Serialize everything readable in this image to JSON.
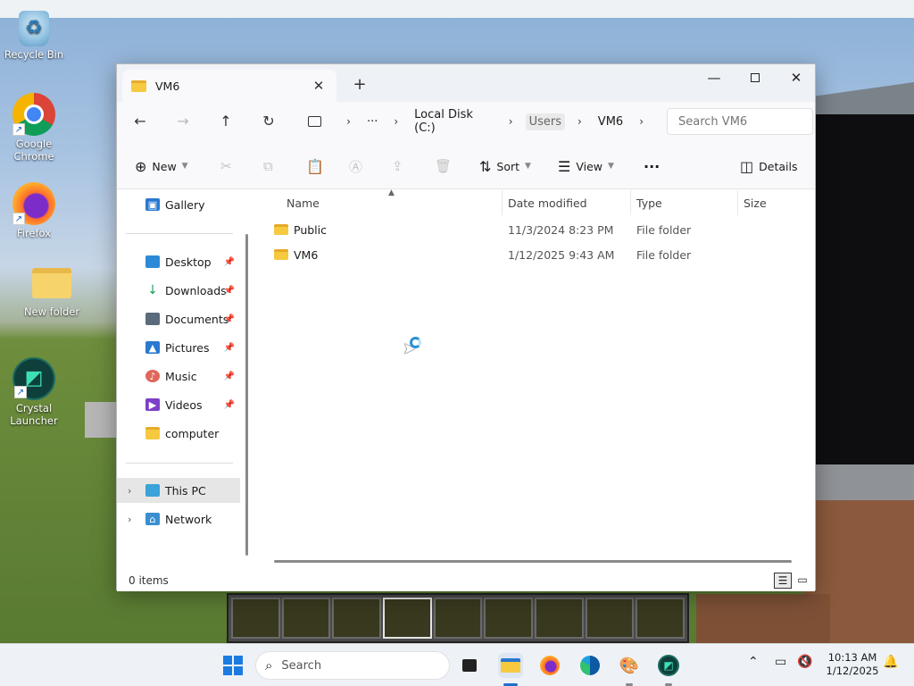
{
  "desktop": {
    "icons": [
      {
        "label": "Recycle Bin",
        "icon": "recycle-bin-icon"
      },
      {
        "label": "Google Chrome",
        "icon": "chrome-icon"
      },
      {
        "label": "Firefox",
        "icon": "firefox-icon"
      },
      {
        "label": "New folder",
        "icon": "folder-icon"
      },
      {
        "label": "Crystal Launcher",
        "icon": "crystal-launcher-icon"
      }
    ]
  },
  "explorer": {
    "tab_title": "VM6",
    "new_tab_symbol": "+",
    "address": {
      "ellipsis": "···",
      "crumbs": [
        "Local Disk (C:)",
        "Users",
        "VM6"
      ]
    },
    "search_placeholder": "Search VM6",
    "toolbar": {
      "new_label": "New",
      "sort_label": "Sort",
      "view_label": "View",
      "more_label": "···",
      "details_label": "Details"
    },
    "sidebar": {
      "gallery": "Gallery",
      "quick_access": [
        {
          "label": "Desktop",
          "color": "#2d8ad6"
        },
        {
          "label": "Downloads",
          "color": "#1f9d55"
        },
        {
          "label": "Documents",
          "color": "#5b6b7b"
        },
        {
          "label": "Pictures",
          "color": "#2b78d0"
        },
        {
          "label": "Music",
          "color": "#e0675b"
        },
        {
          "label": "Videos",
          "color": "#7b3fc9"
        },
        {
          "label": "computer",
          "color": "#f6c93f"
        }
      ],
      "this_pc": "This PC",
      "network": "Network"
    },
    "columns": [
      "Name",
      "Date modified",
      "Type",
      "Size"
    ],
    "rows": [
      {
        "name": "Public",
        "date": "11/3/2024 8:23 PM",
        "type": "File folder"
      },
      {
        "name": "VM6",
        "date": "1/12/2025 9:43 AM",
        "type": "File folder"
      }
    ],
    "status": "0 items"
  },
  "taskbar": {
    "search_placeholder": "Search",
    "time": "10:13 AM",
    "date": "1/12/2025"
  }
}
